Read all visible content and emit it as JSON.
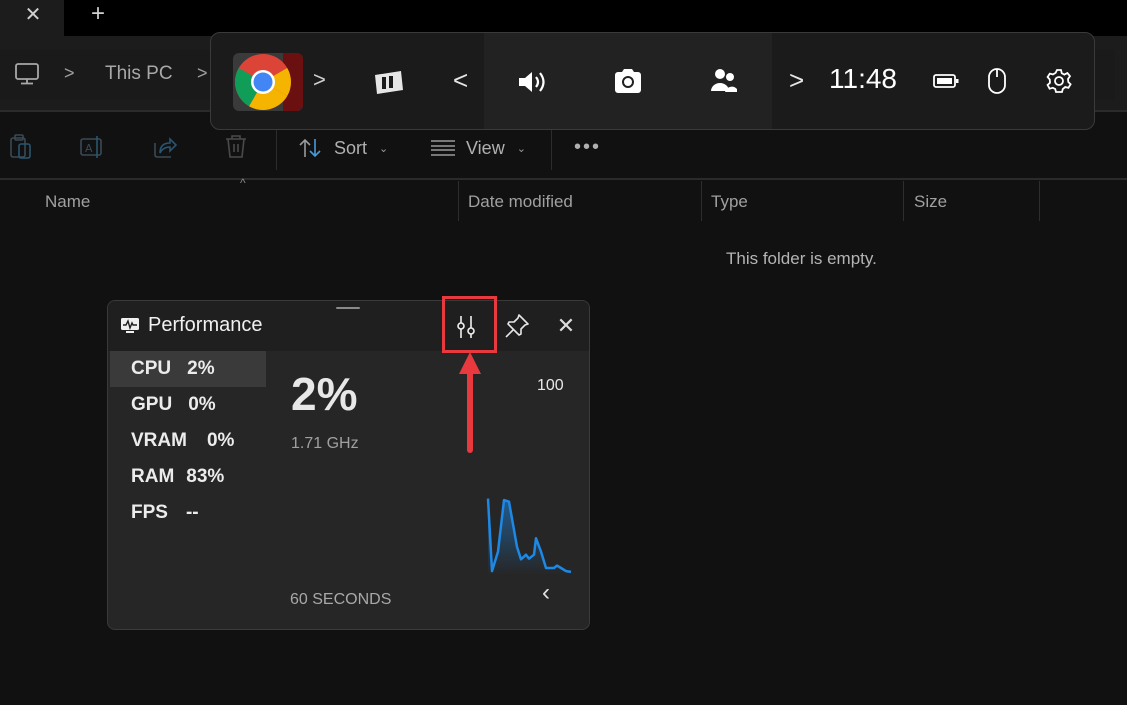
{
  "explorer": {
    "tab_close_icon": "close-icon",
    "new_tab_icon": "plus-icon",
    "breadcrumb": [
      "This PC"
    ],
    "breadcrumb_sep": ">",
    "toolbar": {
      "sort_label": "Sort",
      "view_label": "View",
      "more_label": "•••",
      "chevron": "⌄"
    },
    "columns": [
      "Name",
      "Date modified",
      "Type",
      "Size"
    ],
    "sort_caret": "^",
    "empty_message": "This folder is empty."
  },
  "gamebar": {
    "time": "11:48",
    "expand_glyph": ">",
    "back_glyph": "<",
    "next_glyph": ">"
  },
  "performance": {
    "title": "Performance",
    "metrics": [
      {
        "label": "CPU",
        "value": "2%"
      },
      {
        "label": "GPU",
        "value": "0%"
      },
      {
        "label": "VRAM",
        "value": "0%"
      },
      {
        "label": "RAM",
        "value": "83%"
      },
      {
        "label": "FPS",
        "value": "--"
      }
    ],
    "selected_metric": "CPU",
    "big_value": "2%",
    "frequency": "1.71 GHz",
    "max_label": "100",
    "time_window_label": "60 SECONDS",
    "close_glyph": "✕",
    "collapse_glyph": "‹",
    "accent_color": "#1e88e5",
    "graph_values": [
      98,
      5,
      30,
      96,
      94,
      36,
      20,
      26,
      21,
      26,
      47,
      30,
      9,
      9,
      12,
      9,
      5,
      4
    ]
  },
  "annotation": {
    "color": "#e8393f"
  }
}
